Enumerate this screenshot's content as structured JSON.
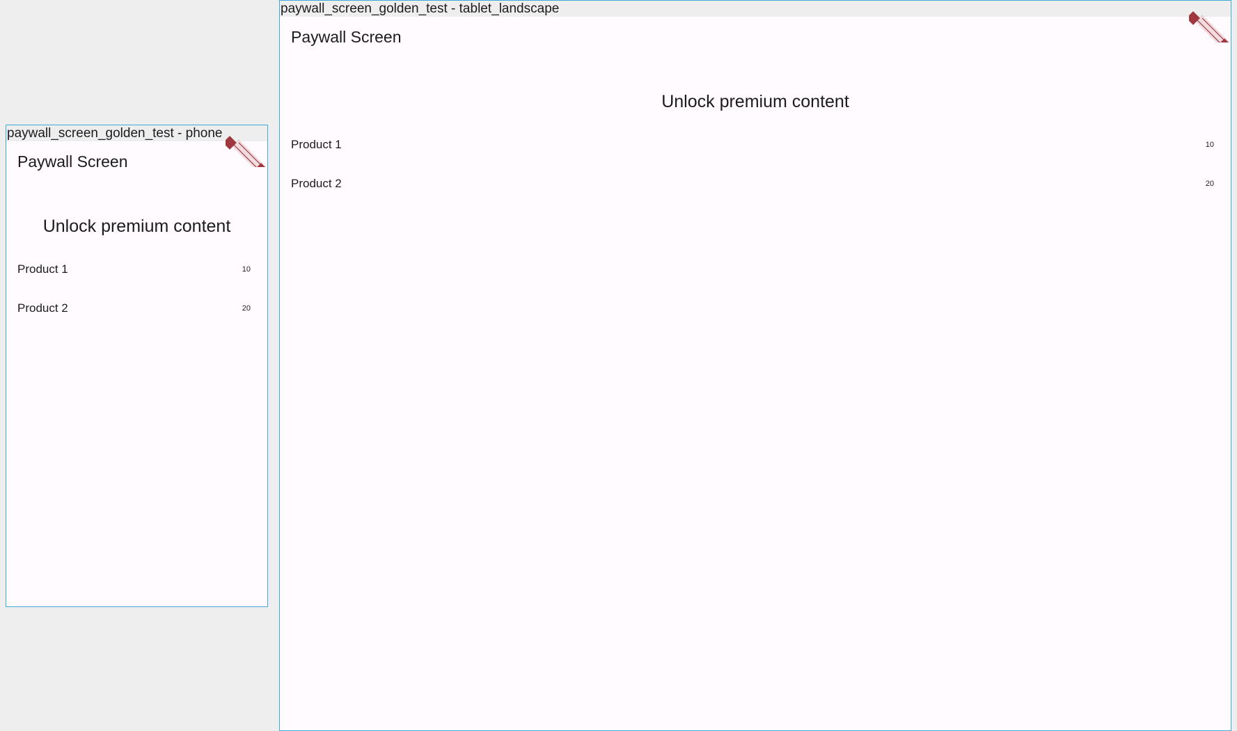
{
  "phone": {
    "label": "paywall_screen_golden_test - phone",
    "app_title": "Paywall Screen",
    "headline": "Unlock premium content",
    "products": [
      {
        "name": "Product 1",
        "price": "10"
      },
      {
        "name": "Product 2",
        "price": "20"
      }
    ]
  },
  "tablet": {
    "label": "paywall_screen_golden_test - tablet_landscape",
    "app_title": "Paywall Screen",
    "headline": "Unlock premium content",
    "products": [
      {
        "name": "Product 1",
        "price": "10"
      },
      {
        "name": "Product 2",
        "price": "20"
      }
    ]
  },
  "colors": {
    "frame_border": "#3fa9d8",
    "surface": "#fffbfe",
    "backdrop": "#eeeeee",
    "debug_banner": "#a0393f",
    "text": "#1c1b1f"
  },
  "icons": {
    "debug_banner": "debug-banner-icon"
  }
}
